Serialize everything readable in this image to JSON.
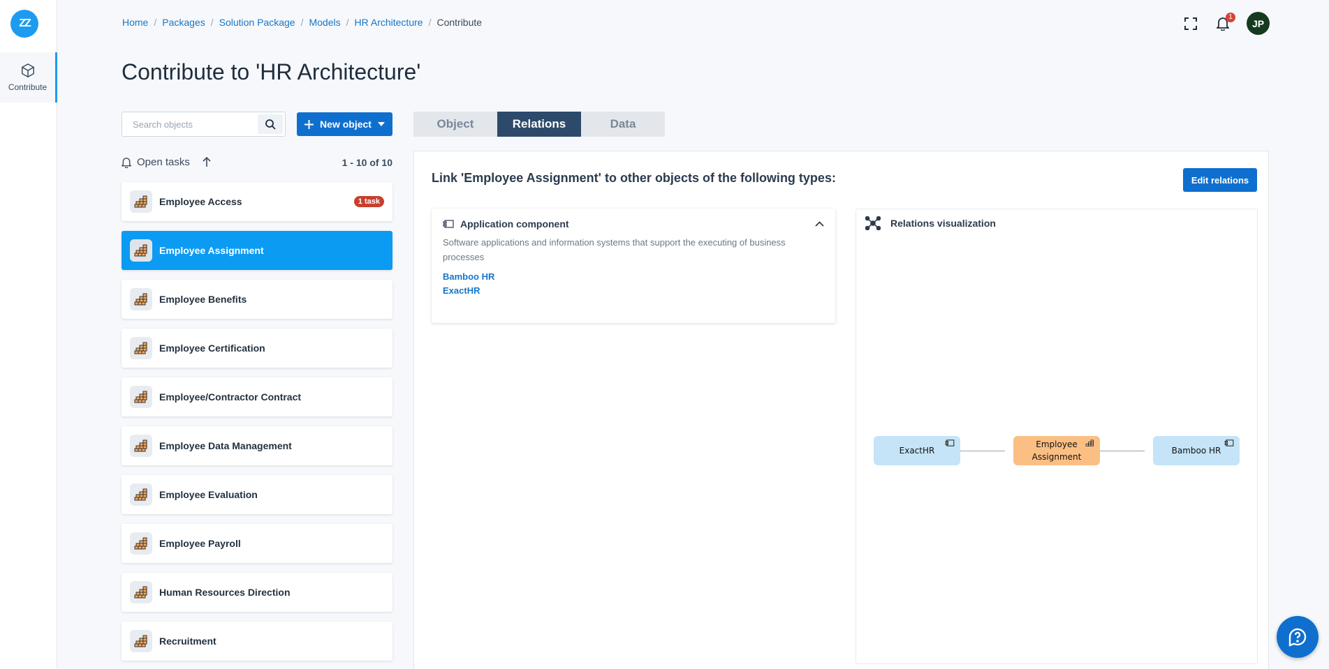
{
  "app": {
    "logo_text": "ZZ",
    "accent": "#1d9bf0"
  },
  "rail": {
    "contribute_label": "Contribute"
  },
  "breadcrumb": [
    "Home",
    "Packages",
    "Solution Package",
    "Models",
    "HR Architecture"
  ],
  "breadcrumb_current": "Contribute",
  "header": {
    "notification_count": "1",
    "avatar_initials": "JP"
  },
  "page_title": "Contribute to 'HR Architecture'",
  "search": {
    "placeholder": "Search objects"
  },
  "new_object_label": "New object",
  "tasks": {
    "label": "Open tasks",
    "count": "1 - 10 of 10"
  },
  "objects": [
    {
      "name": "Employee Access",
      "badge": "1 task"
    },
    {
      "name": "Employee Assignment",
      "active": true
    },
    {
      "name": "Employee Benefits"
    },
    {
      "name": "Employee Certification"
    },
    {
      "name": "Employee/Contractor Contract"
    },
    {
      "name": "Employee Data Management"
    },
    {
      "name": "Employee Evaluation"
    },
    {
      "name": "Employee Payroll"
    },
    {
      "name": "Human Resources Direction"
    },
    {
      "name": "Recruitment"
    }
  ],
  "tabs": [
    "Object",
    "Relations",
    "Data"
  ],
  "relations": {
    "title": "Link 'Employee Assignment' to other objects of the following types:",
    "edit_label": "Edit relations",
    "component": {
      "type": "Application component",
      "description": "Software applications and information systems that support the executing of business processes",
      "links": [
        "Bamboo HR",
        "ExactHR"
      ]
    },
    "viz": {
      "title": "Relations visualization",
      "nodes": {
        "left": "ExactHR",
        "center_line1": "Employee",
        "center_line2": "Assignment",
        "right": "Bamboo HR"
      }
    }
  }
}
